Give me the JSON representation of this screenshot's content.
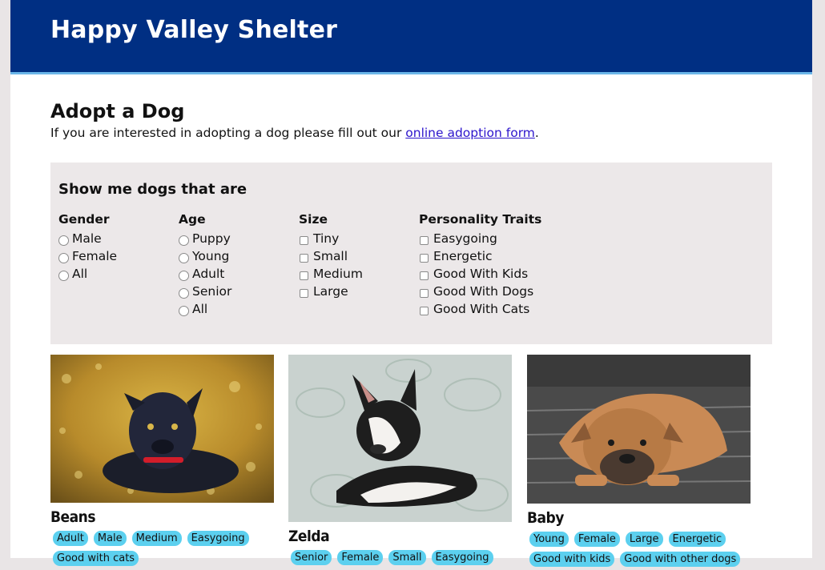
{
  "site": {
    "title": "Happy Valley Shelter"
  },
  "main": {
    "title": "Adopt a Dog",
    "intro_prefix": "If you are interested in adopting a dog please fill out our ",
    "intro_link": "online adoption form",
    "intro_suffix": "."
  },
  "filters": {
    "title": "Show me dogs that are",
    "gender": {
      "title": "Gender",
      "options": [
        "Male",
        "Female",
        "All"
      ]
    },
    "age": {
      "title": "Age",
      "options": [
        "Puppy",
        "Young",
        "Adult",
        "Senior",
        "All"
      ]
    },
    "size": {
      "title": "Size",
      "options": [
        "Tiny",
        "Small",
        "Medium",
        "Large"
      ]
    },
    "traits": {
      "title": "Personality Traits",
      "options": [
        "Easygoing",
        "Energetic",
        "Good With Kids",
        "Good With Dogs",
        "Good With Cats"
      ]
    }
  },
  "dogs": [
    {
      "name": "Beans",
      "tags": [
        "Adult",
        "Male",
        "Medium",
        "Easygoing",
        "Good with cats"
      ]
    },
    {
      "name": "Zelda",
      "tags": [
        "Senior",
        "Female",
        "Small",
        "Easygoing"
      ]
    },
    {
      "name": "Baby",
      "tags": [
        "Young",
        "Female",
        "Large",
        "Energetic",
        "Good with kids",
        "Good with other dogs"
      ]
    }
  ],
  "colors": {
    "header": "#002f83",
    "tag": "#5cd0ef",
    "link": "#2c14cc",
    "filter_bg": "#ece8e9"
  }
}
